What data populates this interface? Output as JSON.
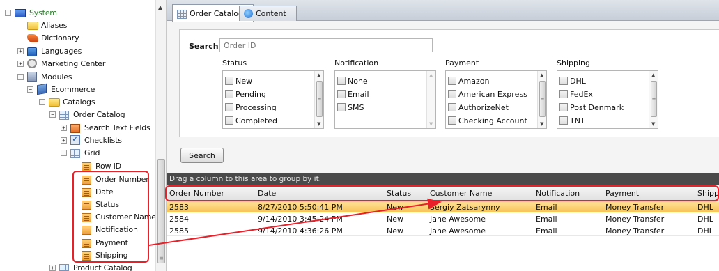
{
  "tree": {
    "items": [
      {
        "label": "System",
        "icon": "system-icon",
        "expander": "−"
      },
      {
        "label": "Aliases",
        "icon": "folder-icon",
        "expander": ""
      },
      {
        "label": "Dictionary",
        "icon": "dictionary-icon",
        "expander": ""
      },
      {
        "label": "Languages",
        "icon": "languages-icon",
        "expander": "+"
      },
      {
        "label": "Marketing Center",
        "icon": "marketing-icon",
        "expander": "+"
      },
      {
        "label": "Modules",
        "icon": "modules-icon",
        "expander": "−"
      },
      {
        "label": "Ecommerce",
        "icon": "ecommerce-icon",
        "expander": "−"
      },
      {
        "label": "Catalogs",
        "icon": "folder-icon",
        "expander": "−"
      },
      {
        "label": "Order Catalog",
        "icon": "grid-icon",
        "expander": "−"
      },
      {
        "label": "Search Text Fields",
        "icon": "fields-icon",
        "expander": "+"
      },
      {
        "label": "Checklists",
        "icon": "checklist-icon",
        "expander": "+"
      },
      {
        "label": "Grid",
        "icon": "grid-icon",
        "expander": "−"
      },
      {
        "label": "Row ID",
        "icon": "column-icon",
        "expander": ""
      },
      {
        "label": "Order Number",
        "icon": "column-icon",
        "expander": ""
      },
      {
        "label": "Date",
        "icon": "column-icon",
        "expander": ""
      },
      {
        "label": "Status",
        "icon": "column-icon",
        "expander": ""
      },
      {
        "label": "Customer Name",
        "icon": "column-icon",
        "expander": ""
      },
      {
        "label": "Notification",
        "icon": "column-icon",
        "expander": ""
      },
      {
        "label": "Payment",
        "icon": "column-icon",
        "expander": ""
      },
      {
        "label": "Shipping",
        "icon": "column-icon",
        "expander": ""
      },
      {
        "label": "Product Catalog",
        "icon": "grid-icon",
        "expander": "+"
      }
    ]
  },
  "tabs": [
    {
      "label": "Order Catalog",
      "icon": "grid-icon"
    },
    {
      "label": "Content",
      "icon": "globe-icon"
    }
  ],
  "search": {
    "label": "Search",
    "placeholder": "Order ID",
    "button_label": "Search"
  },
  "filters": {
    "status": {
      "title": "Status",
      "options": [
        "New",
        "Pending",
        "Processing",
        "Completed"
      ]
    },
    "notification": {
      "title": "Notification",
      "options": [
        "None",
        "Email",
        "SMS"
      ]
    },
    "payment": {
      "title": "Payment",
      "options": [
        "Amazon",
        "American Express",
        "AuthorizeNet",
        "Checking Account"
      ]
    },
    "shipping": {
      "title": "Shipping",
      "options": [
        "DHL",
        "FedEx",
        "Post Denmark",
        "TNT"
      ]
    }
  },
  "grid": {
    "group_hint": "Drag a column to this area to group by it.",
    "columns": [
      "Order Number",
      "Date",
      "Status",
      "Customer Name",
      "Notification",
      "Payment",
      "Shipping"
    ],
    "rows": [
      [
        "2583",
        "8/27/2010 5:50:41 PM",
        "New",
        "Sergiy Zatsarynny",
        "Email",
        "Money Transfer",
        "DHL"
      ],
      [
        "2584",
        "9/14/2010 3:45:24 PM",
        "New",
        "Jane Awesome",
        "Email",
        "Money Transfer",
        "DHL"
      ],
      [
        "2585",
        "9/14/2010 4:36:26 PM",
        "New",
        "Jane Awesome",
        "Email",
        "Money Transfer",
        "DHL"
      ]
    ],
    "selected_row": 0
  },
  "colors": {
    "callout": "#e8202a",
    "selected_row": "#f7c55a",
    "group_bar": "#4a4a4a"
  }
}
